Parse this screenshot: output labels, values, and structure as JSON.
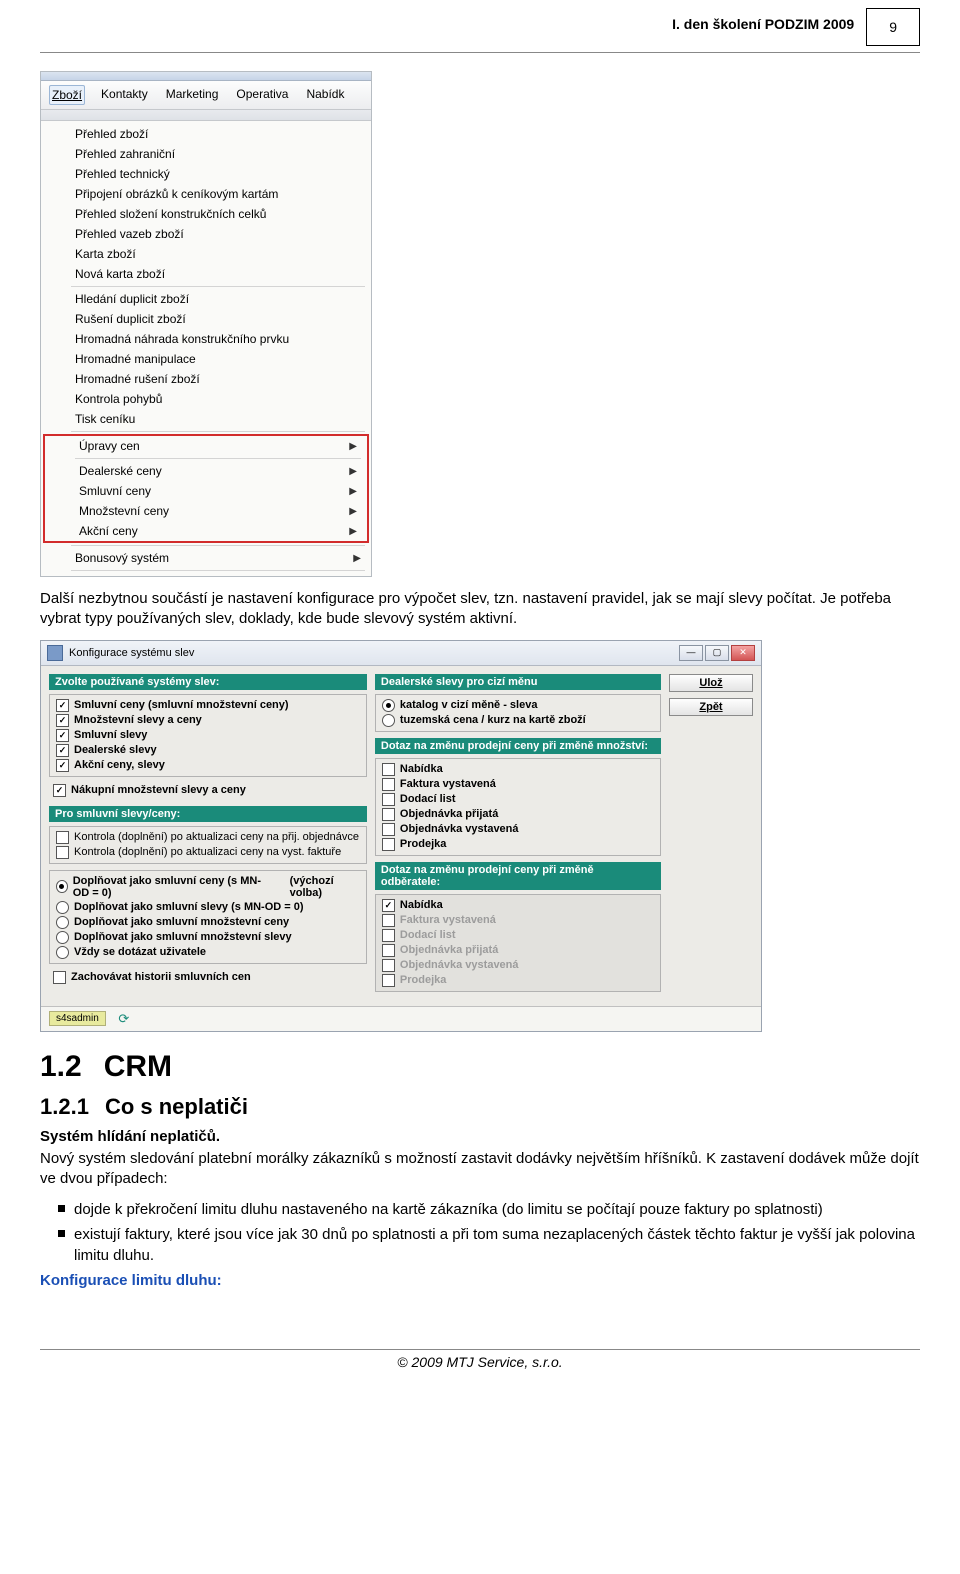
{
  "header": {
    "title": "I. den školení PODZIM 2009",
    "page_number": "9"
  },
  "menu": {
    "menubar": [
      "Zboží",
      "Kontakty",
      "Marketing",
      "Operativa",
      "Nabídk"
    ],
    "items_top": [
      "Přehled zboží",
      "Přehled zahraniční",
      "Přehled technický",
      "Připojení obrázků k ceníkovým kartám",
      "Přehled složení konstrukčních celků",
      "Přehled vazeb zboží",
      "Karta zboží",
      "Nová karta zboží"
    ],
    "items_mid": [
      "Hledání duplicit zboží",
      "Rušení duplicit zboží",
      "Hromadná náhrada konstrukčního prvku",
      "Hromadné manipulace",
      "Hromadné rušení zboží",
      "Kontrola pohybů",
      "Tisk ceníku"
    ],
    "items_sub": [
      "Úpravy cen",
      "Dealerské ceny",
      "Smluvní ceny",
      "Množstevní ceny",
      "Akční ceny"
    ],
    "items_bottom": [
      "Bonusový systém"
    ]
  },
  "para1": "Další nezbytnou součástí je nastavení konfigurace pro výpočet slev, tzn. nastavení pravidel, jak se mají slevy počítat. Je potřeba vybrat typy používaných slev, doklady, kde bude slevový systém aktivní.",
  "dialog": {
    "title": "Konfigurace systému slev",
    "left": {
      "header": "Zvolte používané systémy slev:",
      "systems": [
        {
          "label": "Smluvní ceny (smluvní množstevní ceny)",
          "checked": true
        },
        {
          "label": "Množstevní slevy a ceny",
          "checked": true
        },
        {
          "label": "Smluvní slevy",
          "checked": true
        },
        {
          "label": "Dealerské slevy",
          "checked": true
        },
        {
          "label": "Akční ceny, slevy",
          "checked": true
        },
        {
          "label": "Nákupní množstevní slevy a ceny",
          "checked": true
        }
      ],
      "header2": "Pro smluvní slevy/ceny:",
      "kontrola": [
        {
          "label": "Kontrola (doplnění) po aktualizaci ceny na přij. objednávce",
          "checked": false
        },
        {
          "label": "Kontrola (doplnění) po aktualizaci ceny na vyst. faktuře",
          "checked": false
        }
      ],
      "radios": [
        {
          "label": "Doplňovat jako smluvní ceny (s MN-OD = 0)",
          "suffix": "(výchozí volba)",
          "sel": true
        },
        {
          "label": "Doplňovat jako smluvní slevy (s MN-OD = 0)",
          "suffix": "",
          "sel": false
        },
        {
          "label": "Doplňovat jako smluvní množstevní ceny",
          "suffix": "",
          "sel": false
        },
        {
          "label": "Doplňovat jako smluvní množstevní slevy",
          "suffix": "",
          "sel": false
        },
        {
          "label": "Vždy se dotázat uživatele",
          "suffix": "",
          "sel": false
        }
      ],
      "history": {
        "label": "Zachovávat historii smluvních cen",
        "checked": false
      }
    },
    "mid": {
      "header": "Dealerské slevy pro cizí měnu",
      "radios1": [
        {
          "label": "katalog v cizí měně - sleva",
          "sel": true
        },
        {
          "label": "tuzemská cena / kurz na kartě zboží",
          "sel": false
        }
      ],
      "header2": "Dotaz na změnu prodejní ceny při změně množství:",
      "docs1": [
        {
          "label": "Nabídka",
          "checked": false
        },
        {
          "label": "Faktura vystavená",
          "checked": false
        },
        {
          "label": "Dodací list",
          "checked": false
        },
        {
          "label": "Objednávka přijatá",
          "checked": false
        },
        {
          "label": "Objednávka vystavená",
          "checked": false
        },
        {
          "label": "Prodejka",
          "checked": false
        }
      ],
      "header3": "Dotaz na změnu prodejní ceny při změně odběratele:",
      "docs2": [
        {
          "label": "Nabídka",
          "checked": true,
          "enabled": true
        },
        {
          "label": "Faktura vystavená",
          "checked": false,
          "enabled": false
        },
        {
          "label": "Dodací list",
          "checked": false,
          "enabled": false
        },
        {
          "label": "Objednávka přijatá",
          "checked": false,
          "enabled": false
        },
        {
          "label": "Objednávka vystavená",
          "checked": false,
          "enabled": false
        },
        {
          "label": "Prodejka",
          "checked": false,
          "enabled": false
        }
      ]
    },
    "buttons": {
      "save": "Ulož",
      "back": "Zpět"
    },
    "status_user": "s4sadmin"
  },
  "section12": {
    "num": "1.2",
    "title": "CRM"
  },
  "section121": {
    "num": "1.2.1",
    "title": "Co s neplatiči"
  },
  "sub_bold": "Systém hlídání neplatičů.",
  "para2": "Nový systém sledování platební morálky zákazníků s možností zastavit dodávky největším hříšníků. K zastavení dodávek může dojít ve dvou případech:",
  "bullets": [
    "dojde k překročení limitu dluhu nastaveného na kartě zákazníka (do limitu se počítají pouze faktury po splatnosti)",
    "existují faktury, které jsou více jak 30 dnů po splatnosti a při tom suma nezaplacených částek těchto faktur je vyšší jak polovina limitu dluhu."
  ],
  "blue_text": "Konfigurace limitu dluhu:",
  "footer": "© 2009 MTJ Service, s.r.o."
}
